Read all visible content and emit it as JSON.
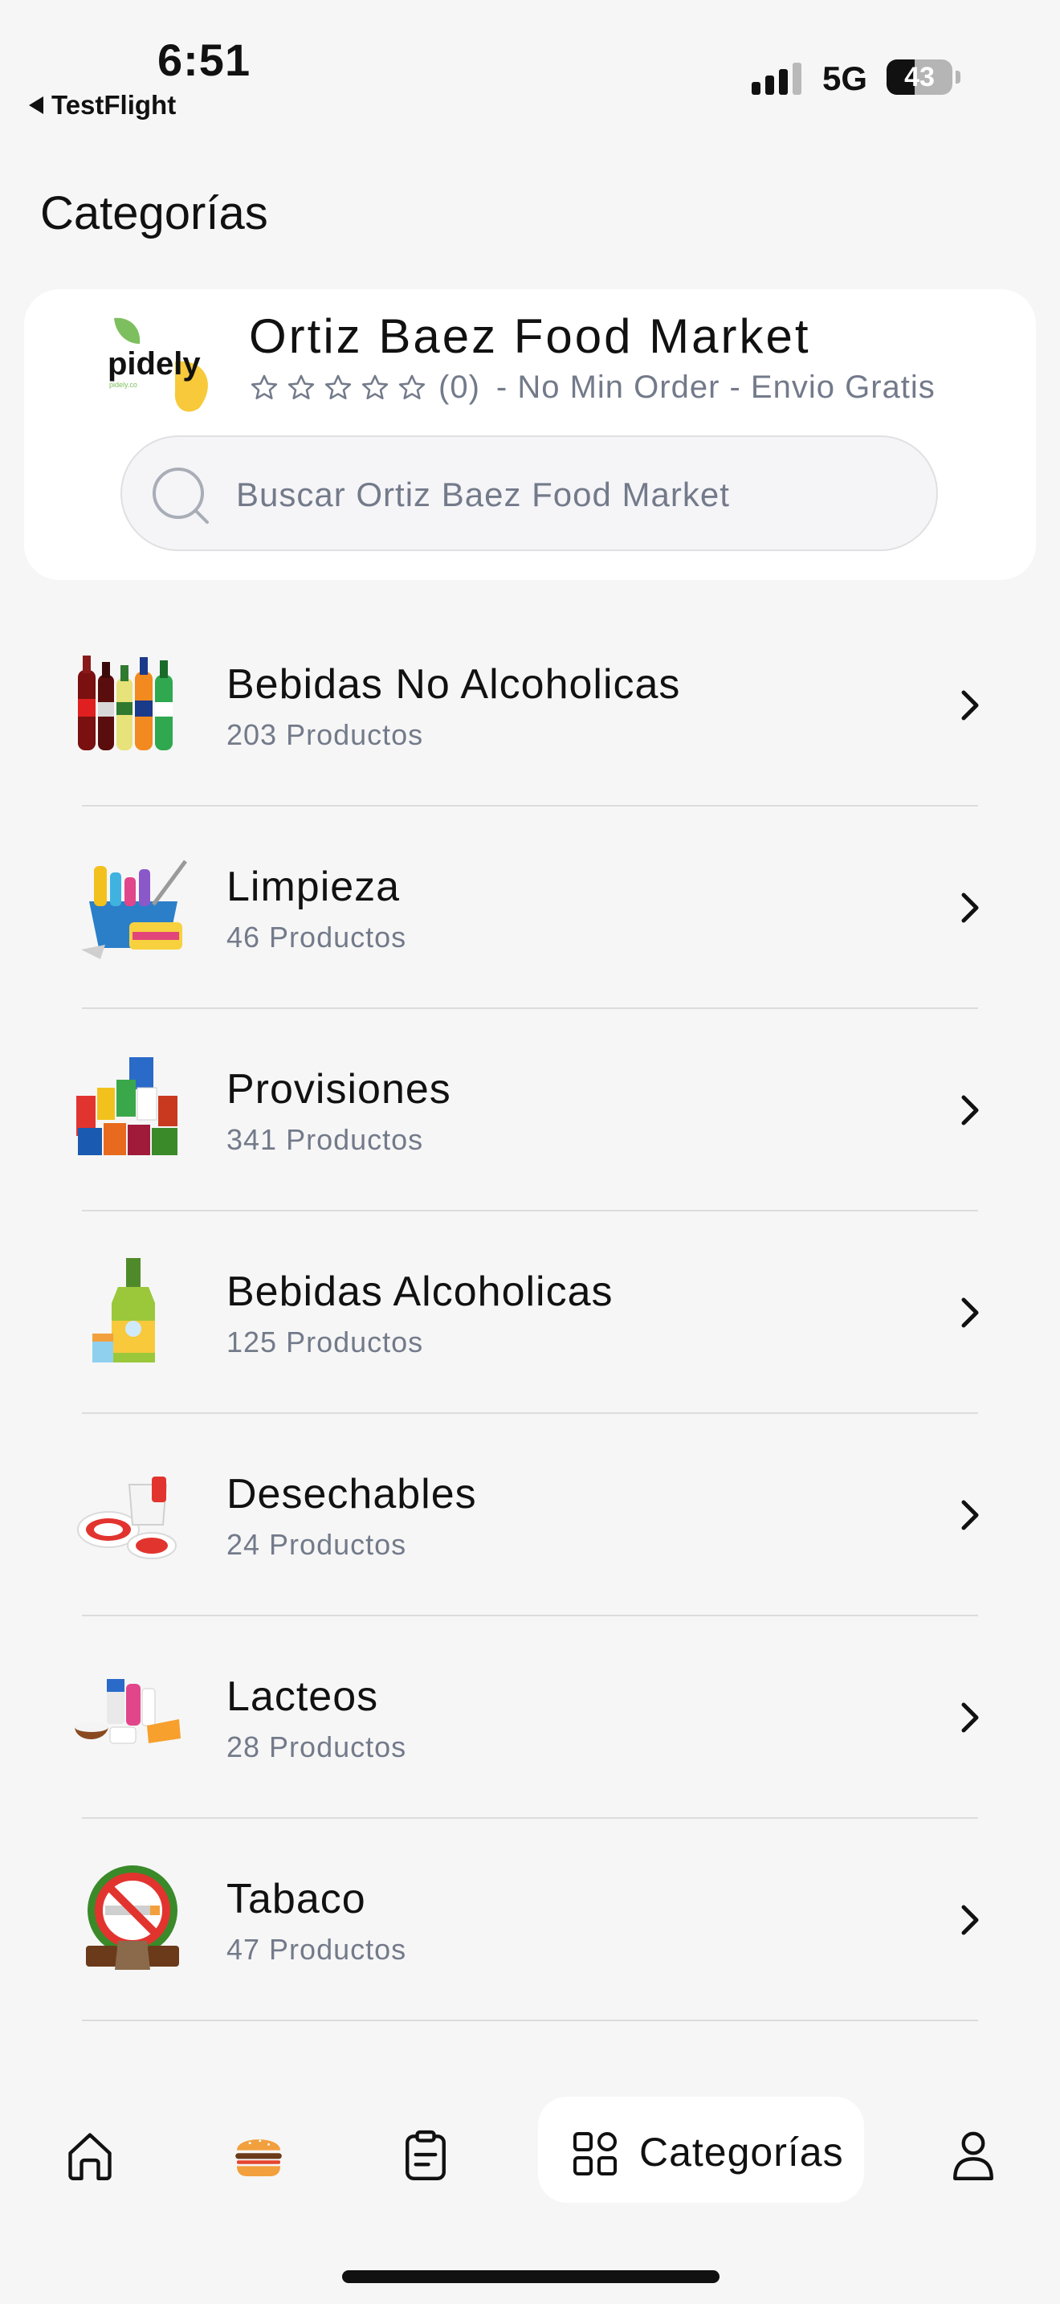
{
  "status_bar": {
    "time": "6:51",
    "back_app": "TestFlight",
    "network": "5G",
    "battery": "43",
    "battery_level": 0.43
  },
  "page": {
    "title": "Categorías"
  },
  "store": {
    "logo_text": "pidely",
    "logo_subtext": "pidely.co",
    "name": "Ortiz Baez Food Market",
    "rating_count": "(0)",
    "rating_value": 0,
    "tagline": "- No Min Order - Envio Gratis",
    "search_placeholder": "Buscar Ortiz Baez Food Market"
  },
  "categories": [
    {
      "name": "Bebidas No Alcoholicas",
      "count": "203 Productos",
      "icon": "soda-bottles-icon"
    },
    {
      "name": "Limpieza",
      "count": "46 Productos",
      "icon": "cleaning-supplies-icon"
    },
    {
      "name": "Provisiones",
      "count": "341 Productos",
      "icon": "groceries-icon"
    },
    {
      "name": "Bebidas Alcoholicas",
      "count": "125 Productos",
      "icon": "liquor-bottle-icon"
    },
    {
      "name": "Desechables",
      "count": "24 Productos",
      "icon": "disposable-plates-icon"
    },
    {
      "name": "Lacteos",
      "count": "28 Productos",
      "icon": "dairy-products-icon"
    },
    {
      "name": "Tabaco",
      "count": "47 Productos",
      "icon": "no-smoking-icon"
    }
  ],
  "bottom_nav": {
    "items": [
      {
        "icon": "home-icon"
      },
      {
        "icon": "burger-icon"
      },
      {
        "icon": "clipboard-icon"
      },
      {
        "icon": "grid-icon",
        "label": "Categorías",
        "active": true
      },
      {
        "icon": "user-icon"
      }
    ]
  },
  "colors": {
    "background": "#f6f6f6",
    "card": "#ffffff",
    "muted_text": "#737a8a",
    "logo_yellow": "#f7c93b",
    "logo_green": "#7dbf5e"
  }
}
